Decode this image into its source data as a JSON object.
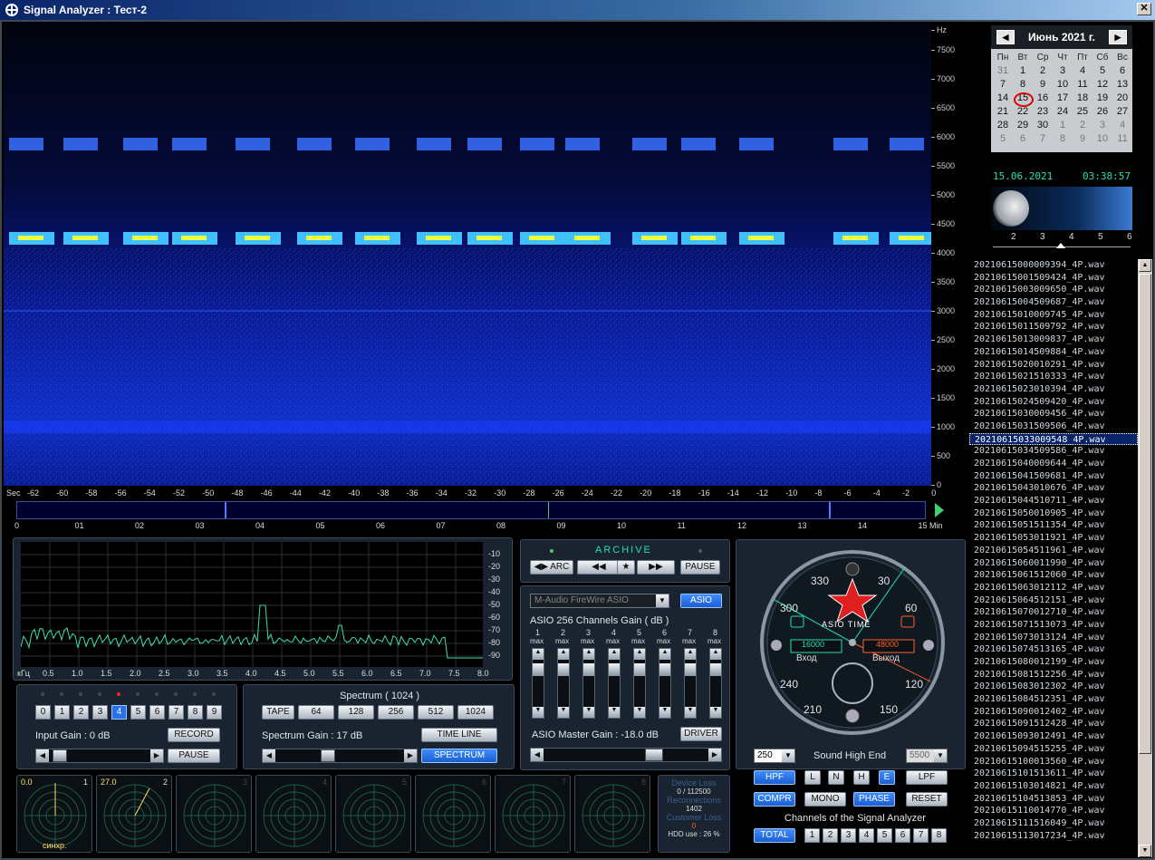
{
  "window": {
    "title": "Signal Analyzer : Тест-2",
    "close_label": "✕"
  },
  "freq_axis": {
    "unit": "Hz",
    "ticks": [
      "7500",
      "7000",
      "6500",
      "6000",
      "5500",
      "5000",
      "4500",
      "4000",
      "3500",
      "3000",
      "2500",
      "2000",
      "1500",
      "1000",
      "500",
      "0"
    ]
  },
  "sec_axis": {
    "unit_label": "Sec",
    "ticks": [
      "-62",
      "-60",
      "-58",
      "-56",
      "-54",
      "-52",
      "-50",
      "-48",
      "-46",
      "-44",
      "-42",
      "-40",
      "-38",
      "-36",
      "-34",
      "-32",
      "-30",
      "-28",
      "-26",
      "-24",
      "-22",
      "-20",
      "-18",
      "-16",
      "-14",
      "-12",
      "-10",
      "-8",
      "-6",
      "-4",
      "-2",
      "0"
    ]
  },
  "min_axis": {
    "ticks": [
      "0",
      "01",
      "02",
      "03",
      "04",
      "05",
      "06",
      "07",
      "08",
      "09",
      "10",
      "11",
      "12",
      "13",
      "14",
      "15 Min"
    ]
  },
  "spectrum": {
    "db_ticks": [
      "-10",
      "-20",
      "-30",
      "-40",
      "-50",
      "-60",
      "-70",
      "-80",
      "-90"
    ],
    "khz_label": "кГц",
    "khz_ticks": [
      "0.5",
      "1.0",
      "1.5",
      "2.0",
      "2.5",
      "3.0",
      "3.5",
      "4.0",
      "4.5",
      "5.0",
      "5.5",
      "6.0",
      "6.5",
      "7.0",
      "7.5",
      "8.0"
    ]
  },
  "input": {
    "channels": [
      "0",
      "1",
      "2",
      "3",
      "4",
      "5",
      "6",
      "7",
      "8",
      "9"
    ],
    "selected": "4",
    "gain_label": "Input Gain : 0 dB",
    "record": "RECORD",
    "pause": "PAUSE"
  },
  "spectrum_ctl": {
    "title": "Spectrum  ( 1024 )",
    "sizes": [
      "TAPE",
      "64",
      "128",
      "256",
      "512",
      "1024"
    ],
    "gain_label": "Spectrum Gain : 17 dB",
    "time_line": "TIME   LINE",
    "spectrum_btn": "SPECTRUM"
  },
  "archive": {
    "title": "ARCHIVE",
    "arc": "ARC",
    "pause": "PAUSE"
  },
  "asio": {
    "device": "M-Audio FireWire ASIO",
    "asio_btn": "ASIO",
    "gain_title": "ASIO 256 Channels Gain ( dB )",
    "channels": [
      "1",
      "2",
      "3",
      "4",
      "5",
      "6",
      "7",
      "8"
    ],
    "max_label": "max",
    "master_gain": "ASIO Master Gain : -18.0 dB",
    "driver": "DRIVER"
  },
  "clock": {
    "labels": [
      "330",
      "30",
      "300",
      "60",
      "240",
      "120",
      "210",
      "150"
    ],
    "asio_time": "ASIO TIME",
    "in_val": "16000",
    "out_val": "48000",
    "in_lbl": "Вход",
    "out_lbl": "Выход"
  },
  "sound": {
    "low": "250",
    "high": "5500",
    "title": "Sound  High  End",
    "hpf": "HPF",
    "l": "L",
    "n": "N",
    "h": "H",
    "e": "E",
    "lpf": "LPF",
    "compr": "COMPR",
    "mono": "MONO",
    "phase": "PHASE",
    "reset": "RESET",
    "channels_title": "Channels of the Signal Analyzer",
    "total": "TOTAL",
    "ch": [
      "1",
      "2",
      "3",
      "4",
      "5",
      "6",
      "7",
      "8"
    ]
  },
  "scopes": [
    {
      "val": "0.0",
      "n": "1",
      "lbl": "синхр."
    },
    {
      "val": "27.0",
      "n": "2",
      "lbl": ""
    },
    {
      "val": "",
      "n": "3",
      "lbl": ""
    },
    {
      "val": "",
      "n": "4",
      "lbl": ""
    },
    {
      "val": "",
      "n": "5",
      "lbl": ""
    },
    {
      "val": "",
      "n": "6",
      "lbl": ""
    },
    {
      "val": "",
      "n": "7",
      "lbl": ""
    },
    {
      "val": "",
      "n": "8",
      "lbl": ""
    }
  ],
  "device": {
    "loss_title": "Device Loss",
    "loss_val": "0 / 112500",
    "reconn_title": "Reconnections",
    "reconn_val": "1402",
    "cust_title": "Customer Loss",
    "cust_val": "0",
    "hdd": "HDD use : 26 %"
  },
  "calendar": {
    "month": "Июнь 2021 г.",
    "days": [
      "Пн",
      "Вт",
      "Ср",
      "Чт",
      "Пт",
      "Сб",
      "Вс"
    ],
    "weeks": [
      [
        "31",
        "1",
        "2",
        "3",
        "4",
        "5",
        "6"
      ],
      [
        "7",
        "8",
        "9",
        "10",
        "11",
        "12",
        "13"
      ],
      [
        "14",
        "15",
        "16",
        "17",
        "18",
        "19",
        "20"
      ],
      [
        "21",
        "22",
        "23",
        "24",
        "25",
        "26",
        "27"
      ],
      [
        "28",
        "29",
        "30",
        "1",
        "2",
        "3",
        "4"
      ],
      [
        "5",
        "6",
        "7",
        "8",
        "9",
        "10",
        "11"
      ]
    ],
    "today": "15"
  },
  "status": {
    "date": "15.06.2021",
    "time": "03:38:57"
  },
  "moon_scale": [
    "2",
    "3",
    "4",
    "5",
    "6"
  ],
  "files": [
    "20210615000009394_4P.wav",
    "20210615001509424_4P.wav",
    "20210615003009650_4P.wav",
    "20210615004509687_4P.wav",
    "20210615010009745_4P.wav",
    "20210615011509792_4P.wav",
    "20210615013009837_4P.wav",
    "20210615014509884_4P.wav",
    "20210615020010291_4P.wav",
    "20210615021510333_4P.wav",
    "20210615023010394_4P.wav",
    "20210615024509420_4P.wav",
    "20210615030009456_4P.wav",
    "20210615031509506_4P.wav",
    "20210615033009548_4P.wav",
    "20210615034509586_4P.wav",
    "20210615040009644_4P.wav",
    "20210615041509681_4P.wav",
    "20210615043010676_4P.wav",
    "20210615044510711_4P.wav",
    "20210615050010905_4P.wav",
    "20210615051511354_4P.wav",
    "20210615053011921_4P.wav",
    "20210615054511961_4P.wav",
    "20210615060011990_4P.wav",
    "20210615061512060_4P.wav",
    "20210615063012112_4P.wav",
    "20210615064512151_4P.wav",
    "20210615070012710_4P.wav",
    "20210615071513073_4P.wav",
    "20210615073013124_4P.wav",
    "20210615074513165_4P.wav",
    "20210615080012199_4P.wav",
    "20210615081512256_4P.wav",
    "20210615083012302_4P.wav",
    "20210615084512351_4P.wav",
    "20210615090012402_4P.wav",
    "20210615091512428_4P.wav",
    "20210615093012491_4P.wav",
    "20210615094515255_4P.wav",
    "20210615100013560_4P.wav",
    "20210615101513611_4P.wav",
    "20210615103014821_4P.wav",
    "20210615104513853_4P.wav",
    "20210615110014770_4P.wav",
    "20210615111516049_4P.wav",
    "20210615113017234_4P.wav"
  ],
  "selected_file": "20210615033009548_4P.wav"
}
